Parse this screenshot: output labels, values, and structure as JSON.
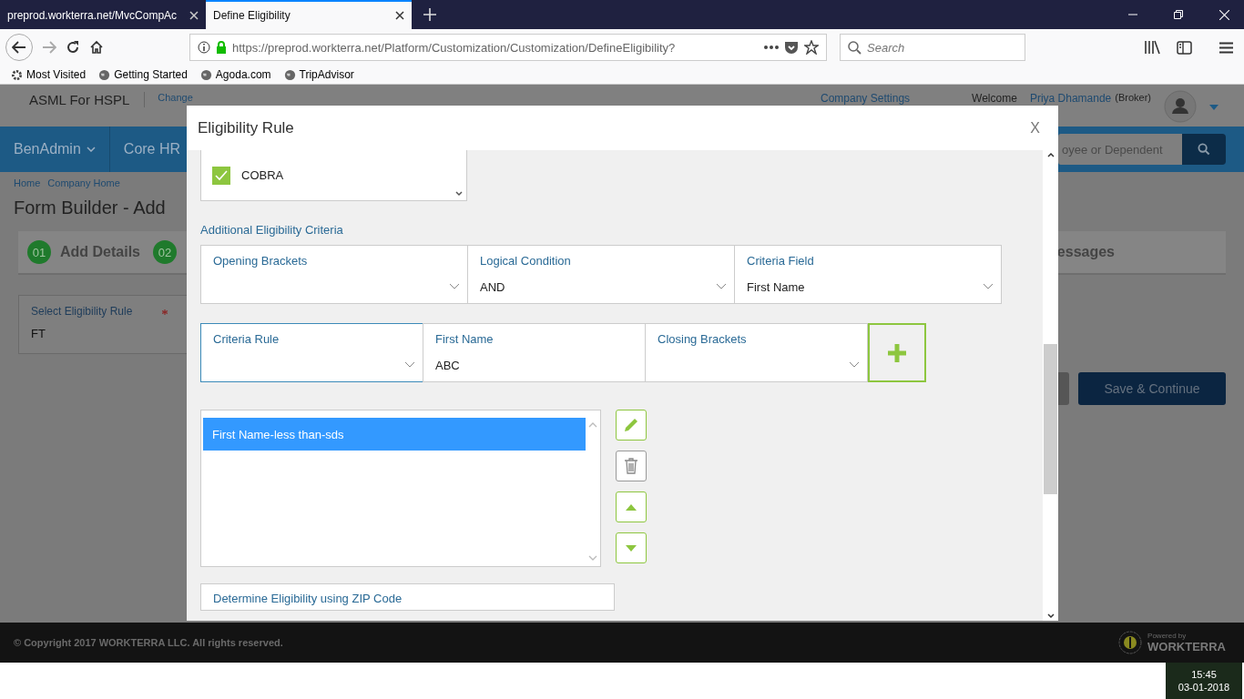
{
  "browser": {
    "tabs": [
      {
        "title": "preprod.workterra.net/MvcCompAc",
        "selected": false
      },
      {
        "title": "Define Eligibility",
        "selected": true
      }
    ],
    "address": "https://preprod.workterra.net/Platform/Customization/Customization/DefineEligibility?",
    "search_placeholder": "Search",
    "bookmarks": [
      "Most Visited",
      "Getting Started",
      "Agoda.com",
      "TripAdvisor"
    ]
  },
  "app": {
    "company": "ASML For HSPL",
    "change_link": "Change",
    "company_settings": "Company Settings",
    "welcome": "Welcome",
    "user_name": "Priya Dhamande",
    "user_role": "(Broker)",
    "nav": [
      {
        "label": "BenAdmin",
        "has_menu": true
      },
      {
        "label": "Core HR",
        "has_menu": false
      }
    ],
    "search_placeholder": "oyee or Dependent",
    "breadcrumbs": [
      "Home",
      "Company Home"
    ],
    "page_title": "Form Builder - Add",
    "steps": [
      {
        "number": "01",
        "label": "Add Details"
      },
      {
        "number": "02"
      }
    ],
    "steps_end": "essages",
    "field": {
      "label": "Select Eligibility Rule",
      "required": true,
      "value": "FT"
    },
    "save_button": "Save & Continue",
    "copyright": "© Copyright 2017 WORKTERRA LLC. All rights reserved.",
    "powered_by": "Powered by",
    "brand": "WORKTERRA"
  },
  "modal": {
    "title": "Eligibility Rule",
    "close": "X",
    "program": {
      "label": "COBRA",
      "checked": true
    },
    "section_title": "Additional Eligibility Criteria",
    "criteria_row1": [
      {
        "label": "Opening Brackets",
        "focused": false
      },
      {
        "label": "Logical Condition",
        "value": "AND",
        "focused": false
      },
      {
        "label": "Criteria Field",
        "value": "First Name",
        "focused": false
      }
    ],
    "criteria_row2": [
      {
        "kind": "select",
        "label": "Criteria Rule",
        "focused": true
      },
      {
        "kind": "input",
        "label": "First Name",
        "value": "ABC",
        "focused": false
      },
      {
        "kind": "select",
        "label": "Closing Brackets",
        "focused": false
      }
    ],
    "rules": [
      {
        "text": "First Name-less than-sds",
        "selected": true
      }
    ],
    "zip_label": "Determine Eligibility using ZIP Code"
  },
  "taskbar": {
    "time": "15:45",
    "date": "03-01-2018"
  }
}
